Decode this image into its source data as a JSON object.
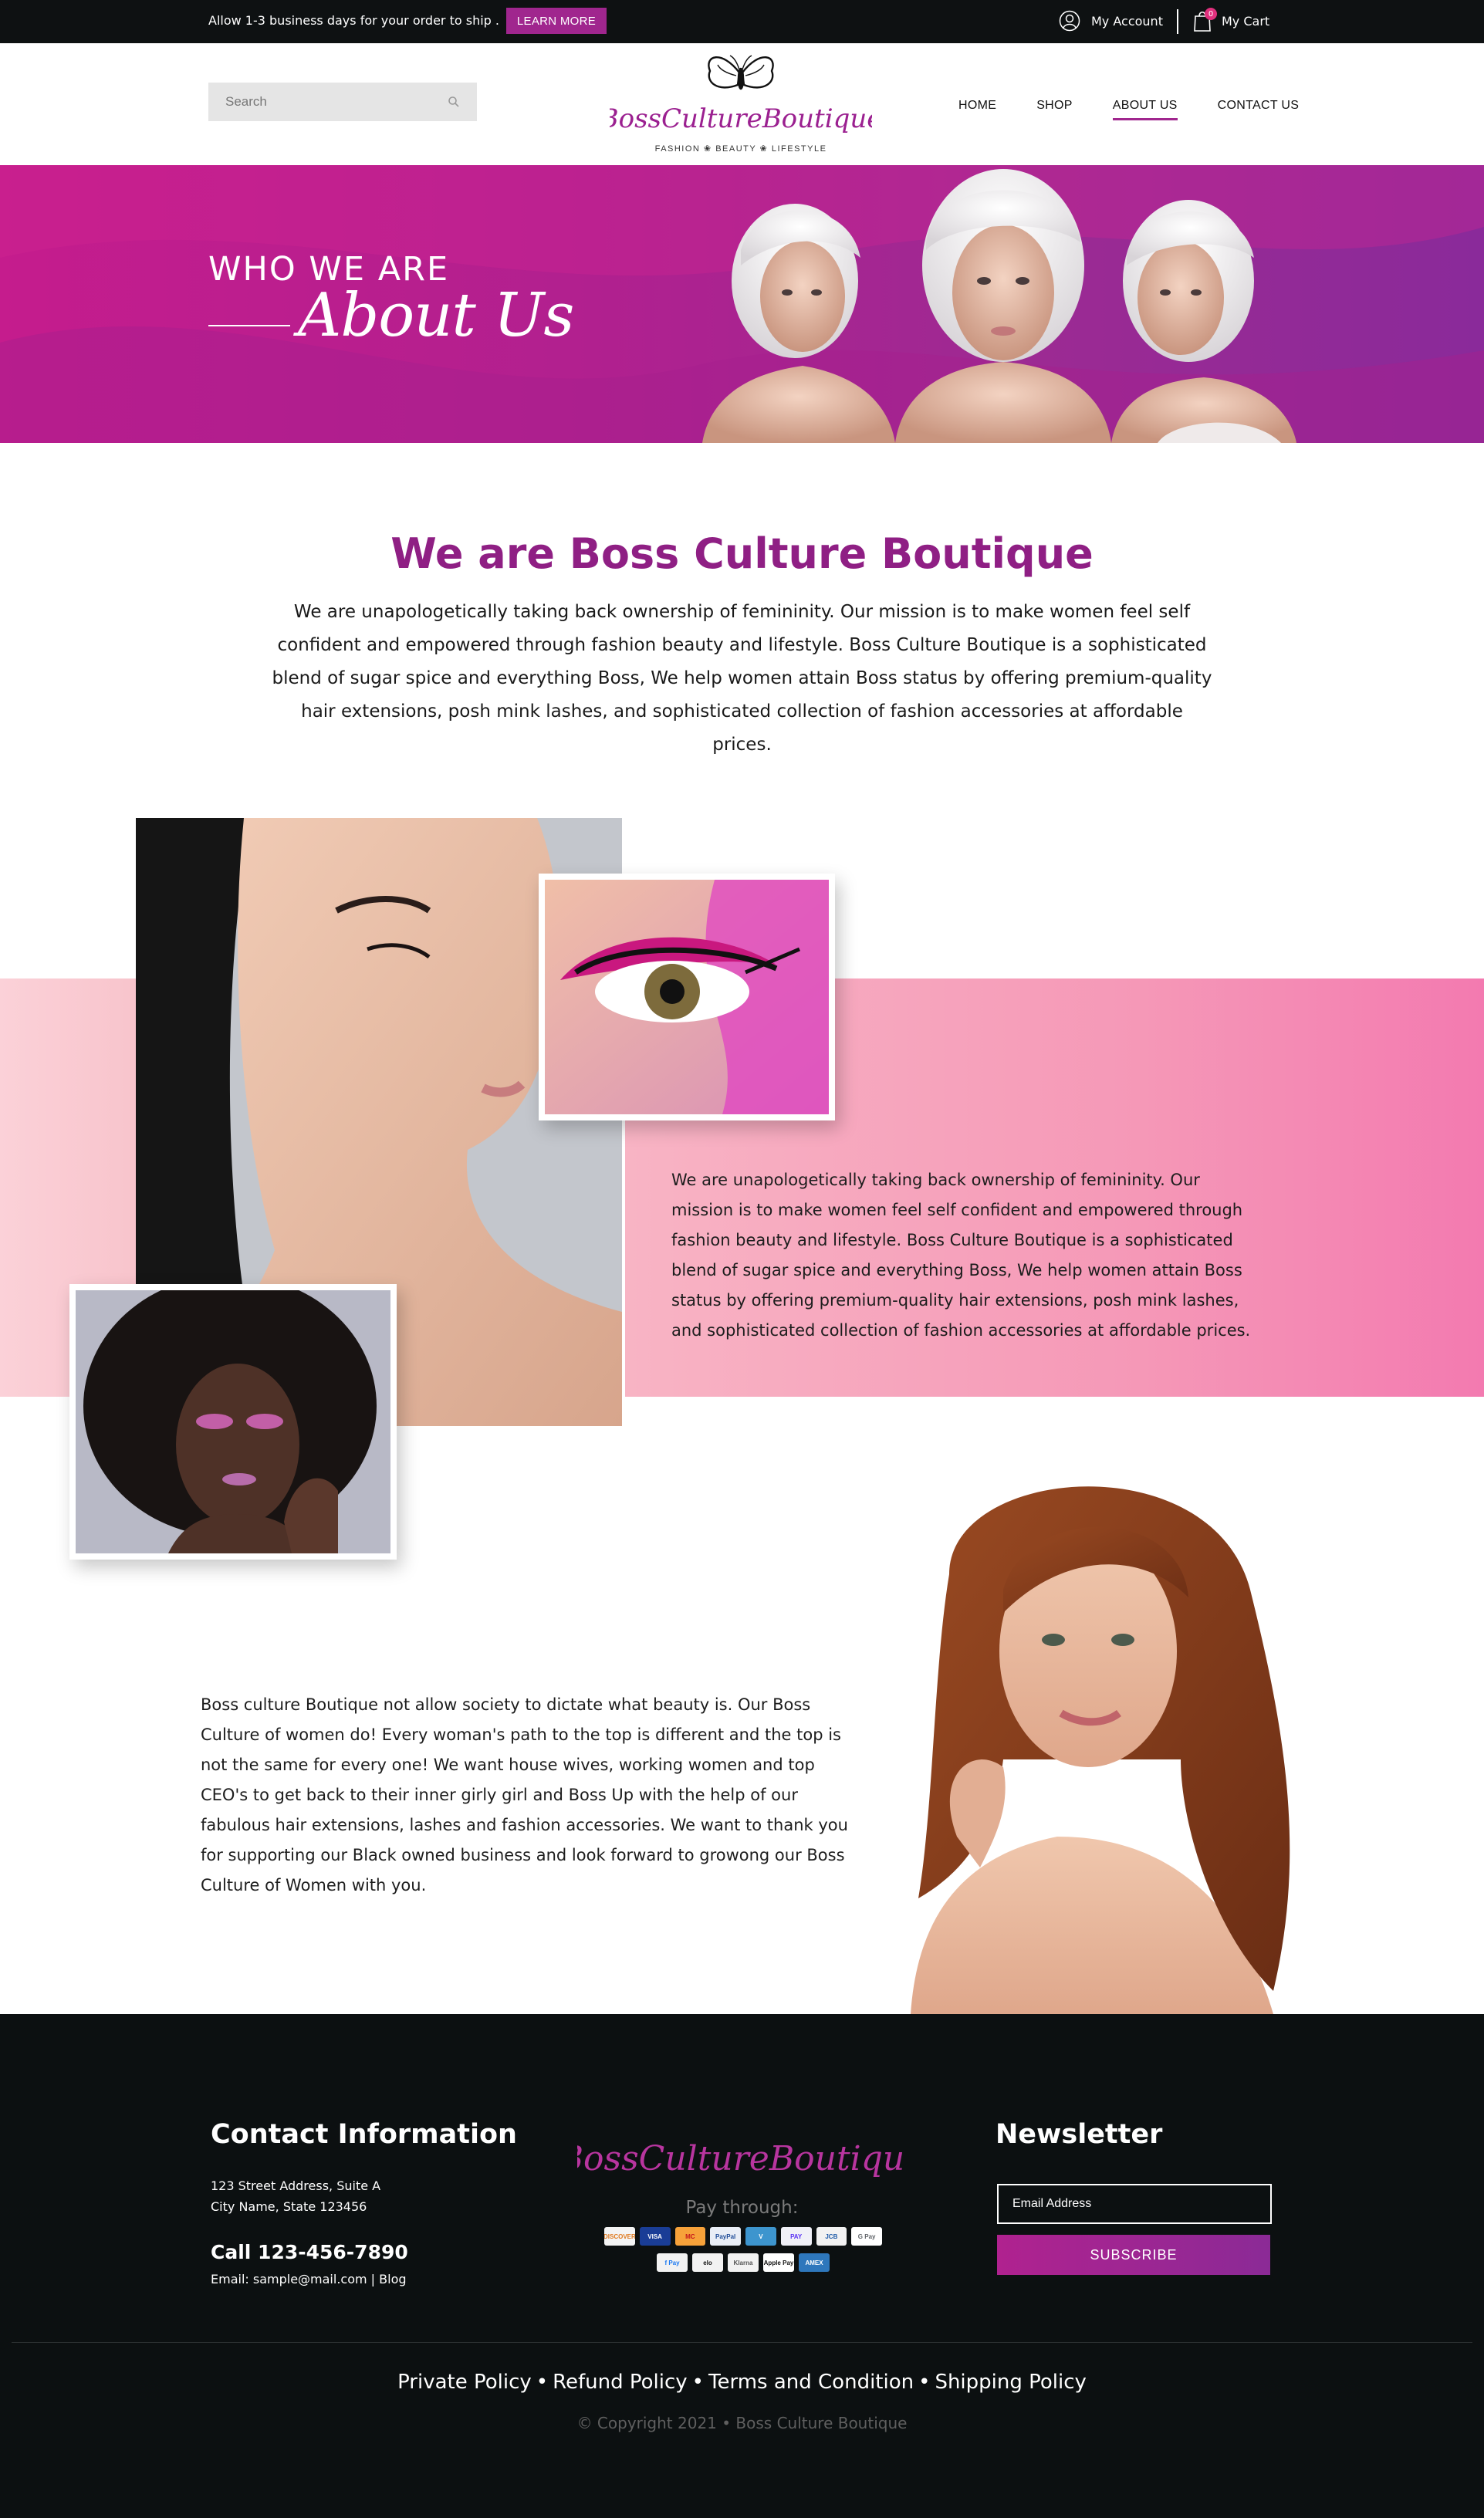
{
  "topbar": {
    "notice": "Allow 1-3 business days for your order to ship .",
    "learn_more": "LEARN MORE",
    "account": "My Account",
    "cart": "My Cart",
    "cart_count": "0"
  },
  "header": {
    "search_placeholder": "Search",
    "logo": {
      "name": "BossCultureBoutique",
      "tagline": "FASHION ❀ BEAUTY ❀ LIFESTYLE"
    },
    "nav": [
      {
        "label": "HOME",
        "active": false
      },
      {
        "label": "SHOP",
        "active": false
      },
      {
        "label": "ABOUT US",
        "active": true
      },
      {
        "label": "CONTACT US",
        "active": false
      }
    ]
  },
  "hero": {
    "kicker": "WHO WE ARE",
    "title": "About Us"
  },
  "intro": {
    "title": "We are Boss Culture Boutique",
    "text": "We are unapologetically taking back ownership of femininity. Our mission is to make women feel self confident and empowered through fashion beauty and lifestyle. Boss Culture Boutique is a sophisticated blend of sugar spice and everything Boss, We help women attain Boss status by offering premium-quality hair extensions, posh mink lashes, and sophisticated collection of fashion accessories at affordable prices."
  },
  "feature": {
    "text": "We are unapologetically taking back ownership of femininity. Our mission is to make women feel self confident and empowered through fashion beauty and lifestyle. Boss Culture Boutique is a sophisticated blend of sugar spice and everything Boss, We help women attain Boss status by offering premium-quality hair extensions, posh mink lashes, and sophisticated collection of fashion accessories at affordable prices."
  },
  "story": {
    "text": "Boss culture Boutique not allow society to dictate what beauty is. Our Boss Culture of women do! Every woman's path to the top is different and the top is not the same for every one! We want house wives, working women and top CEO's to get back to their inner girly girl and Boss Up with the help of our fabulous hair extensions, lashes and fashion accessories. We want to thank you for supporting our Black owned business and look forward to growong our Boss Culture of Women with you."
  },
  "footer": {
    "contact_title": "Contact Information",
    "address_line1": "123 Street Address, Suite A",
    "address_line2": "City Name, State 123456",
    "phone": "Call 123-456-7890",
    "email_label": "Email: sample@mail.com | Blog",
    "logo": "BossCultureBoutique",
    "pay_through": "Pay through:",
    "payment_cards_row1": [
      "DISCOVER",
      "VISA",
      "MC",
      "PayPal",
      "V",
      "PAY",
      "JCB",
      "G Pay"
    ],
    "payment_cards_row2": [
      "f Pay",
      "elo",
      "Klarna",
      "Apple Pay",
      "AMEX"
    ],
    "newsletter_title": "Newsletter",
    "email_placeholder": "Email Address",
    "subscribe": "SUBSCRIBE",
    "links": [
      "Private Policy",
      "Refund Policy",
      "Terms and Condition",
      "Shipping Policy"
    ],
    "copyright": "© Copyright 2021 •  Boss Culture Boutique"
  },
  "colors": {
    "brand_purple": "#8f1f84",
    "button_purple": "#a0268e",
    "hero_magenta": "#c51c8d",
    "pink_band": "#f598b7",
    "dark": "#0c1011"
  }
}
